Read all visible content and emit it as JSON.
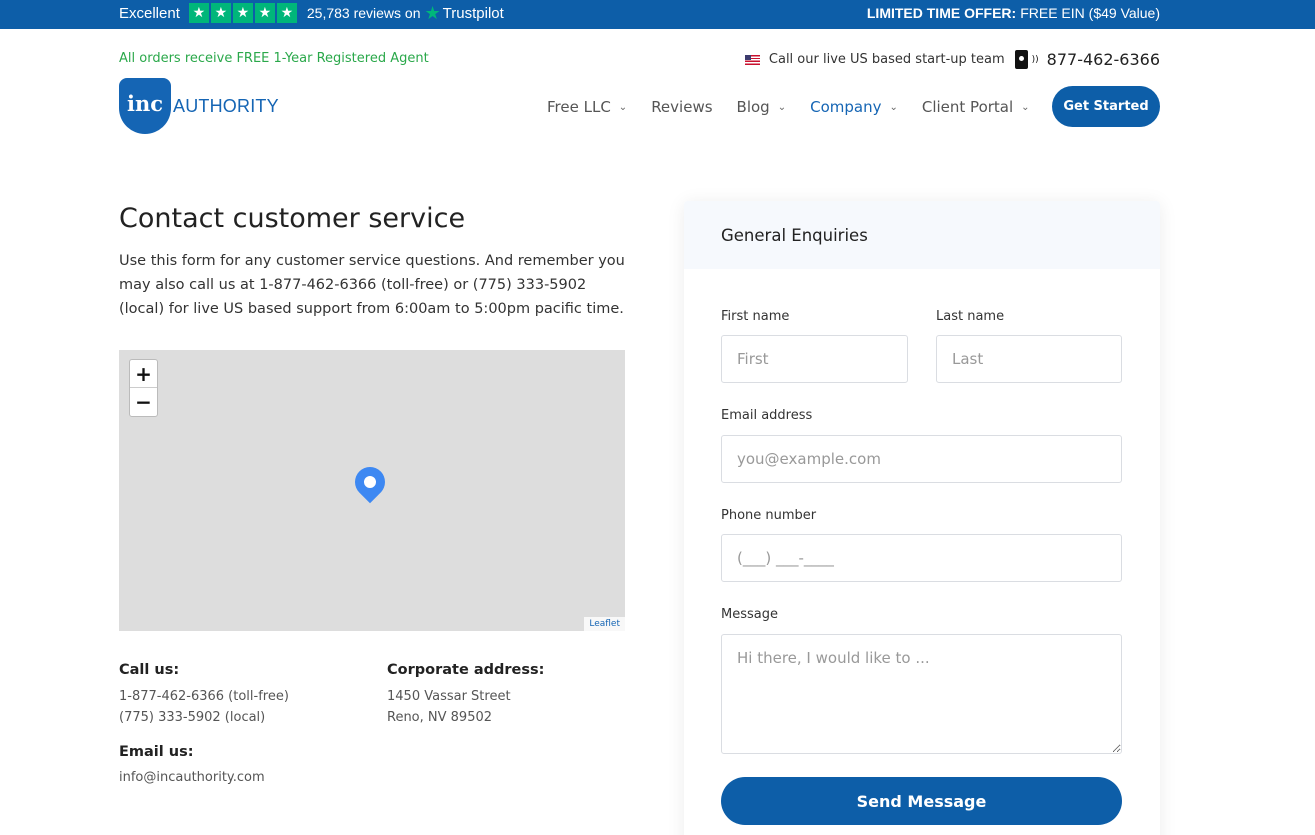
{
  "topbar": {
    "excellent": "Excellent",
    "star_glyph": "★",
    "reviews": "25,783 reviews on",
    "trustpilot_star": "★",
    "trustpilot": "Trustpilot",
    "offer_bold": "LIMITED TIME OFFER:",
    "offer_text": "FREE EIN ($49 Value)",
    "colors": {
      "bar": "#0d5ea8",
      "stars": "#00b67a"
    }
  },
  "header": {
    "promo": "All orders receive FREE 1-Year Registered Agent",
    "call_text": "Call our live US based start-up team",
    "phone": "877-462-6366",
    "logo_mark": "inc",
    "logo_text": "AUTHORITY",
    "nav": [
      {
        "label": "Free LLC",
        "dropdown": true
      },
      {
        "label": "Reviews",
        "dropdown": false
      },
      {
        "label": "Blog",
        "dropdown": true
      },
      {
        "label": "Company",
        "dropdown": true
      },
      {
        "label": "Client Portal",
        "dropdown": true
      }
    ],
    "chevron_glyph": "⌄",
    "cta": "Get Started"
  },
  "main": {
    "title": "Contact customer service",
    "intro": "Use this form for any customer service questions. And remember you may also call us at 1-877-462-6366 (toll-free) or (775) 333-5902 (local) for live US based support from 6:00am to 5:00pm pacific time.",
    "map": {
      "zoom_in": "+",
      "zoom_out": "−",
      "attribution": "Leaflet"
    },
    "call_us": {
      "heading": "Call us:",
      "line1": "1-877-462-6366 (toll-free)",
      "line2": "(775) 333-5902 (local)"
    },
    "address": {
      "heading": "Corporate address:",
      "line1": "1450 Vassar Street",
      "line2": "Reno, NV 89502"
    },
    "email": {
      "heading": "Email us:",
      "value": "info@incauthority.com"
    }
  },
  "form": {
    "title": "General Enquiries",
    "first_label": "First name",
    "first_placeholder": "First",
    "last_label": "Last name",
    "last_placeholder": "Last",
    "email_label": "Email address",
    "email_placeholder": "you@example.com",
    "phone_label": "Phone number",
    "phone_placeholder": "(___) ___-____",
    "message_label": "Message",
    "message_placeholder": "Hi there, I would like to ...",
    "submit": "Send Message"
  }
}
